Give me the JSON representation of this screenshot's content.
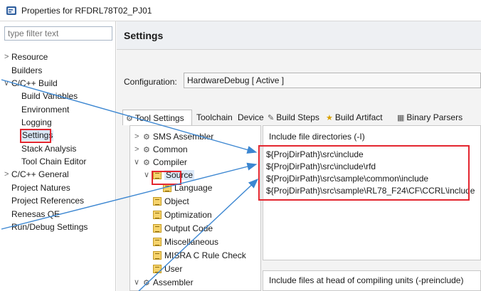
{
  "window": {
    "title": "Properties for RFDRL78T02_PJ01"
  },
  "filter": {
    "placeholder": "type filter text"
  },
  "nav": {
    "resource": "Resource",
    "builders": "Builders",
    "cc_build": "C/C++ Build",
    "build_variables": "Build Variables",
    "environment": "Environment",
    "logging": "Logging",
    "settings": "Settings",
    "stack_analysis": "Stack Analysis",
    "tool_chain_editor": "Tool Chain Editor",
    "cc_general": "C/C++ General",
    "project_natures": "Project Natures",
    "project_references": "Project References",
    "renesas_qe": "Renesas QE",
    "run_debug": "Run/Debug Settings"
  },
  "main": {
    "title": "Settings",
    "config_label": "Configuration:",
    "config_value": "HardwareDebug  [ Active ]"
  },
  "tabs": {
    "tool_settings": "Tool Settings",
    "toolchain": "Toolchain",
    "device": "Device",
    "build_steps": "Build Steps",
    "build_artifact": "Build Artifact",
    "binary_parsers": "Binary Parsers"
  },
  "tree": {
    "sms_assembler": "SMS Assembler",
    "common": "Common",
    "compiler": "Compiler",
    "source": "Source",
    "language": "Language",
    "object": "Object",
    "optimization": "Optimization",
    "output_code": "Output Code",
    "miscellaneous": "Miscellaneous",
    "misra": "MISRA C Rule Check",
    "user": "User",
    "assembler": "Assembler"
  },
  "include": {
    "title": "Include file directories (-I)",
    "paths": [
      "${ProjDirPath}\\src\\include",
      "${ProjDirPath}\\src\\include\\rfd",
      "${ProjDirPath}\\src\\sample\\common\\include",
      "${ProjDirPath}\\src\\sample\\RL78_F24\\CF\\CCRL\\include"
    ]
  },
  "preinclude": {
    "title": "Include files at head of compiling units (-preinclude)"
  },
  "colors": {
    "highlight": "#e3262f",
    "arrow": "#3b86d1",
    "selection": "#dbe8f8"
  }
}
